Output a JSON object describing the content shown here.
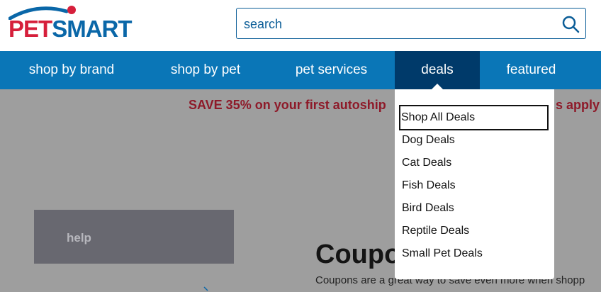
{
  "header": {
    "logo_part1": "PET",
    "logo_part2": "SMART",
    "search_placeholder": "search"
  },
  "nav": {
    "items": [
      {
        "label": "shop by brand"
      },
      {
        "label": "shop by pet"
      },
      {
        "label": "pet services"
      },
      {
        "label": "deals",
        "active": true
      },
      {
        "label": "featured"
      }
    ]
  },
  "content": {
    "promo_text": "SAVE 35% on your first autoship",
    "promo_suffix": "s apply",
    "help_label": "help",
    "coupons_title": "Coupo",
    "coupons_desc": "Coupons are a great way to save even more when shopp"
  },
  "deals_menu": {
    "items": [
      {
        "label": "Shop All Deals",
        "focused": true
      },
      {
        "label": "Dog Deals"
      },
      {
        "label": "Cat Deals"
      },
      {
        "label": "Fish Deals"
      },
      {
        "label": "Bird Deals"
      },
      {
        "label": "Reptile Deals"
      },
      {
        "label": "Small Pet Deals"
      }
    ]
  },
  "colors": {
    "brand_red": "#d61f3b",
    "brand_blue": "#0a67a8",
    "nav_blue": "#0a76b7",
    "nav_active": "#003a6a"
  }
}
